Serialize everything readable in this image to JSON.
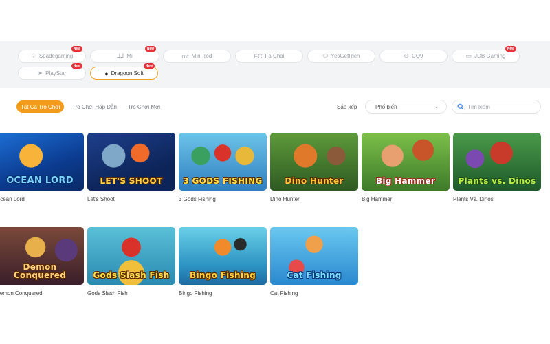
{
  "providers": [
    {
      "label": "Spadegaming",
      "badge": "New",
      "icon": "spade-icon"
    },
    {
      "label": "Mi",
      "badge": "New",
      "icon": "mi-icon"
    },
    {
      "label": "Mini Tod",
      "badge": "",
      "icon": "minitod-icon"
    },
    {
      "label": "Fa Chai",
      "badge": "",
      "icon": "fachai-icon"
    },
    {
      "label": "YesGetRich",
      "badge": "",
      "icon": "yesgetrich-icon"
    },
    {
      "label": "CQ9",
      "badge": "",
      "icon": "cq9-icon"
    },
    {
      "label": "JDB Gaming",
      "badge": "New",
      "icon": "jdb-icon"
    },
    {
      "label": "PlayStar",
      "badge": "New",
      "icon": "playstar-icon"
    },
    {
      "label": "Dragoon Soft",
      "badge": "New",
      "icon": "dragoon-icon",
      "active": true
    }
  ],
  "tabs": [
    {
      "label": "Tất Cả Trò Chơi",
      "active": true
    },
    {
      "label": "Trò Chơi Hấp Dẫn"
    },
    {
      "label": "Trò Chơi Mới"
    }
  ],
  "sort": {
    "label": "Sắp xếp",
    "value": "Phổ biến"
  },
  "search": {
    "placeholder": "Tìm kiếm"
  },
  "games": [
    {
      "name": "Ocean Lord",
      "logo": "OCEAN LORD"
    },
    {
      "name": "Let's Shoot",
      "logo": "LET'S SHOOT"
    },
    {
      "name": "3 Gods Fishing",
      "logo": "3 GODS FISHING"
    },
    {
      "name": "Dino Hunter",
      "logo": "Dino Hunter"
    },
    {
      "name": "Big Hammer",
      "logo": "Big Hammer"
    },
    {
      "name": "Plants Vs. Dinos",
      "logo": "Plants vs. Dinos"
    },
    {
      "name": "Demon Conquered",
      "logo": "Demon Conquered"
    },
    {
      "name": "Gods Slash Fish",
      "logo": "Gods Slash Fish"
    },
    {
      "name": "Bingo Fishing",
      "logo": "Bingo Fishing"
    },
    {
      "name": "Cat Fishing",
      "logo": "Cat Fishing"
    }
  ],
  "colors": {
    "accent": "#f39c1b",
    "badge": "#e8323a",
    "bar": "#f3f4f6"
  }
}
